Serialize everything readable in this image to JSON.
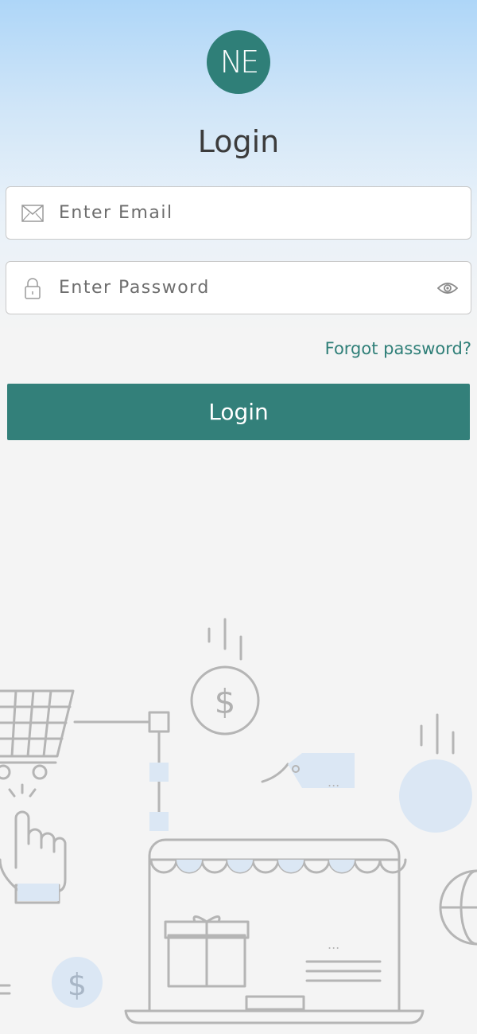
{
  "logo": {
    "text": "NE"
  },
  "header": {
    "title": "Login"
  },
  "email": {
    "placeholder": "Enter Email",
    "value": ""
  },
  "password": {
    "placeholder": "Enter Password",
    "value": ""
  },
  "links": {
    "forgot": "Forgot password?"
  },
  "actions": {
    "login_label": "Login"
  },
  "illustration": {
    "price_symbol": "$",
    "tag_text": "...",
    "laptop_dots": "..."
  },
  "colors": {
    "brand": "#2f7f78",
    "button": "#33807a",
    "illustration_stroke": "#b5b5b5",
    "illustration_fill": "#dbe7f4"
  }
}
